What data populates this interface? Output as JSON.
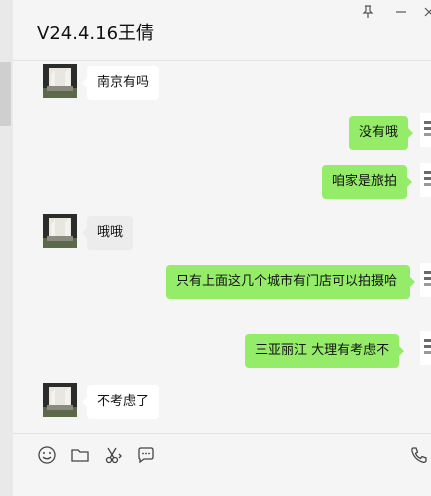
{
  "window": {
    "title": "V24.4.16王倩"
  },
  "messages": [
    {
      "side": "left",
      "text": "南京有吗"
    },
    {
      "side": "right",
      "text": "没有哦"
    },
    {
      "side": "right",
      "text": "咱家是旅拍"
    },
    {
      "side": "left",
      "text": "哦哦"
    },
    {
      "side": "right",
      "text": "只有上面这几个城市有门店可以拍摄哈"
    },
    {
      "side": "right",
      "text": "三亚丽江 大理有考虑不"
    },
    {
      "side": "left",
      "text": "不考虑了"
    }
  ],
  "icons": {
    "pin": "pin-icon",
    "minimize": "minimize-icon",
    "close": "close-icon",
    "emoji": "emoji-icon",
    "folder": "folder-icon",
    "scissors": "scissors-icon",
    "chat": "chat-bubble-icon",
    "phone": "phone-icon"
  },
  "colors": {
    "sent_bubble": "#95ec69",
    "received_bubble": "#ffffff",
    "background": "#f5f5f5"
  }
}
